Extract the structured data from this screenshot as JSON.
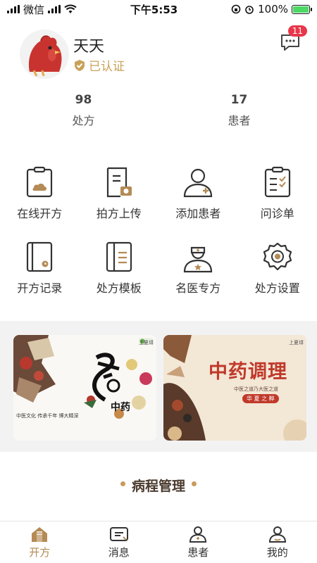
{
  "status_bar": {
    "carrier": "微信",
    "time": "下午5:53",
    "battery": "100%",
    "battery_level": 1.0
  },
  "profile": {
    "name": "天天",
    "certified_label": "已认证",
    "message_badge": "11"
  },
  "stats": [
    {
      "value": "98",
      "label": "处方"
    },
    {
      "value": "17",
      "label": "患者"
    }
  ],
  "actions": [
    {
      "label": "在线开方",
      "icon": "clipboard-cloud-icon"
    },
    {
      "label": "拍方上传",
      "icon": "photo-upload-icon"
    },
    {
      "label": "添加患者",
      "icon": "add-patient-icon"
    },
    {
      "label": "问诊单",
      "icon": "checklist-icon"
    },
    {
      "label": "开方记录",
      "icon": "record-icon"
    },
    {
      "label": "处方模板",
      "icon": "template-icon"
    },
    {
      "label": "名医专方",
      "icon": "doctor-icon"
    },
    {
      "label": "处方设置",
      "icon": "settings-gear-icon"
    }
  ],
  "banners": [
    {
      "brand": "上夏㘫",
      "title": "养",
      "subtitle": "中药",
      "text": "中医文化 传承千年 博大精深"
    },
    {
      "brand": "上夏㘫",
      "title": "中药调理",
      "subtitle": "中医之道乃大医之道",
      "tag": "华 夏 之 粹"
    }
  ],
  "section": {
    "title": "病程管理"
  },
  "tabbar": [
    {
      "label": "开方",
      "icon": "home-icon",
      "active": true
    },
    {
      "label": "消息",
      "icon": "message-icon",
      "active": false
    },
    {
      "label": "患者",
      "icon": "patient-icon",
      "active": false
    },
    {
      "label": "我的",
      "icon": "profile-icon",
      "active": false
    }
  ],
  "colors": {
    "accent": "#b48a55",
    "badge": "#e8374a",
    "cert": "#c9a25a"
  }
}
